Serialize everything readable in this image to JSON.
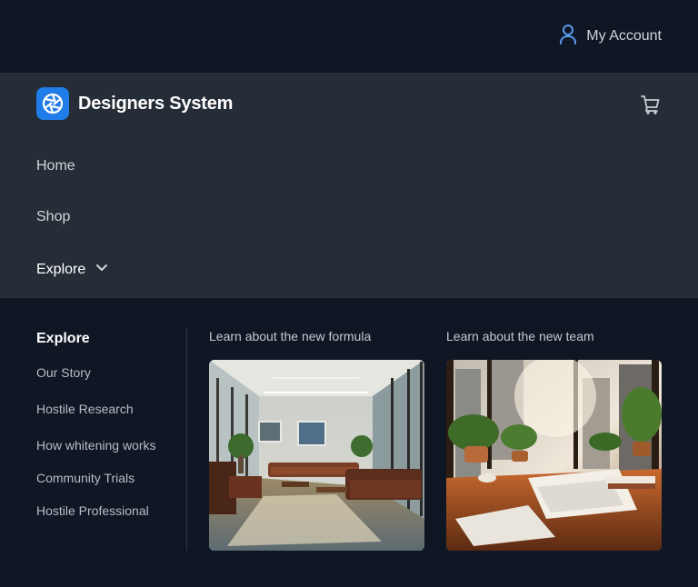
{
  "header": {
    "account_label": "My Account",
    "account_icon": "user-icon",
    "cart_icon": "cart-icon"
  },
  "brand": {
    "name": "Designers System",
    "logo_icon": "aperture-logo-icon",
    "logo_color": "#1f7ce8"
  },
  "nav": {
    "items": [
      {
        "label": "Home"
      },
      {
        "label": "Shop"
      },
      {
        "label": "Explore",
        "icon": "chevron-down-icon"
      }
    ]
  },
  "explore_menu": {
    "title": "Explore",
    "links": [
      {
        "label": "Our Story"
      },
      {
        "label": "Hostile Research"
      },
      {
        "label": "How whitening works"
      },
      {
        "label": "Community Trials"
      },
      {
        "label": "Hostile Professional"
      }
    ],
    "cards": [
      {
        "caption": "Learn about the new formula",
        "image": "office-lounge-interior-photo"
      },
      {
        "caption": "Learn about the new team",
        "image": "desk-with-plants-and-papers-photo"
      }
    ]
  },
  "colors": {
    "page_bg": "#0f1624",
    "nav_bg": "#252d36",
    "accent": "#1f7ce8",
    "account_icon": "#5b9cf0"
  }
}
